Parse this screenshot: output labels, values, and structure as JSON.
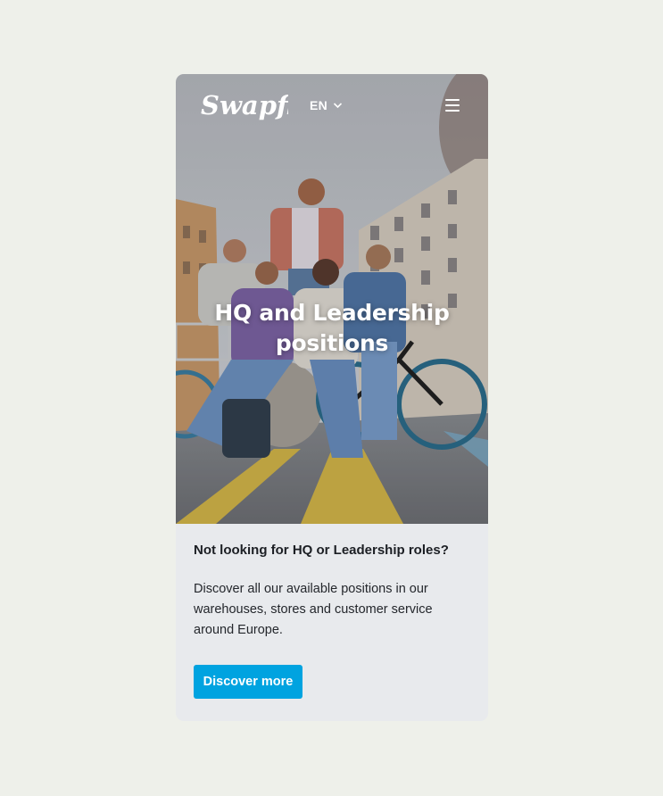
{
  "header": {
    "logo_text": "Swapfiets",
    "language": "EN"
  },
  "hero": {
    "title": "HQ and Leadership positions"
  },
  "section": {
    "heading": "Not looking for HQ or Leadership roles?",
    "body": "Discover all our available positions in our warehouses, stores and customer service around Europe.",
    "button_label": "Discover more"
  },
  "colors": {
    "page_background": "#eef0ea",
    "card_background": "#e8eaed",
    "button_background": "#00a3e0",
    "button_text": "#ffffff"
  },
  "icons": {
    "language_chevron": "chevron-down-icon",
    "menu": "hamburger-menu-icon"
  }
}
